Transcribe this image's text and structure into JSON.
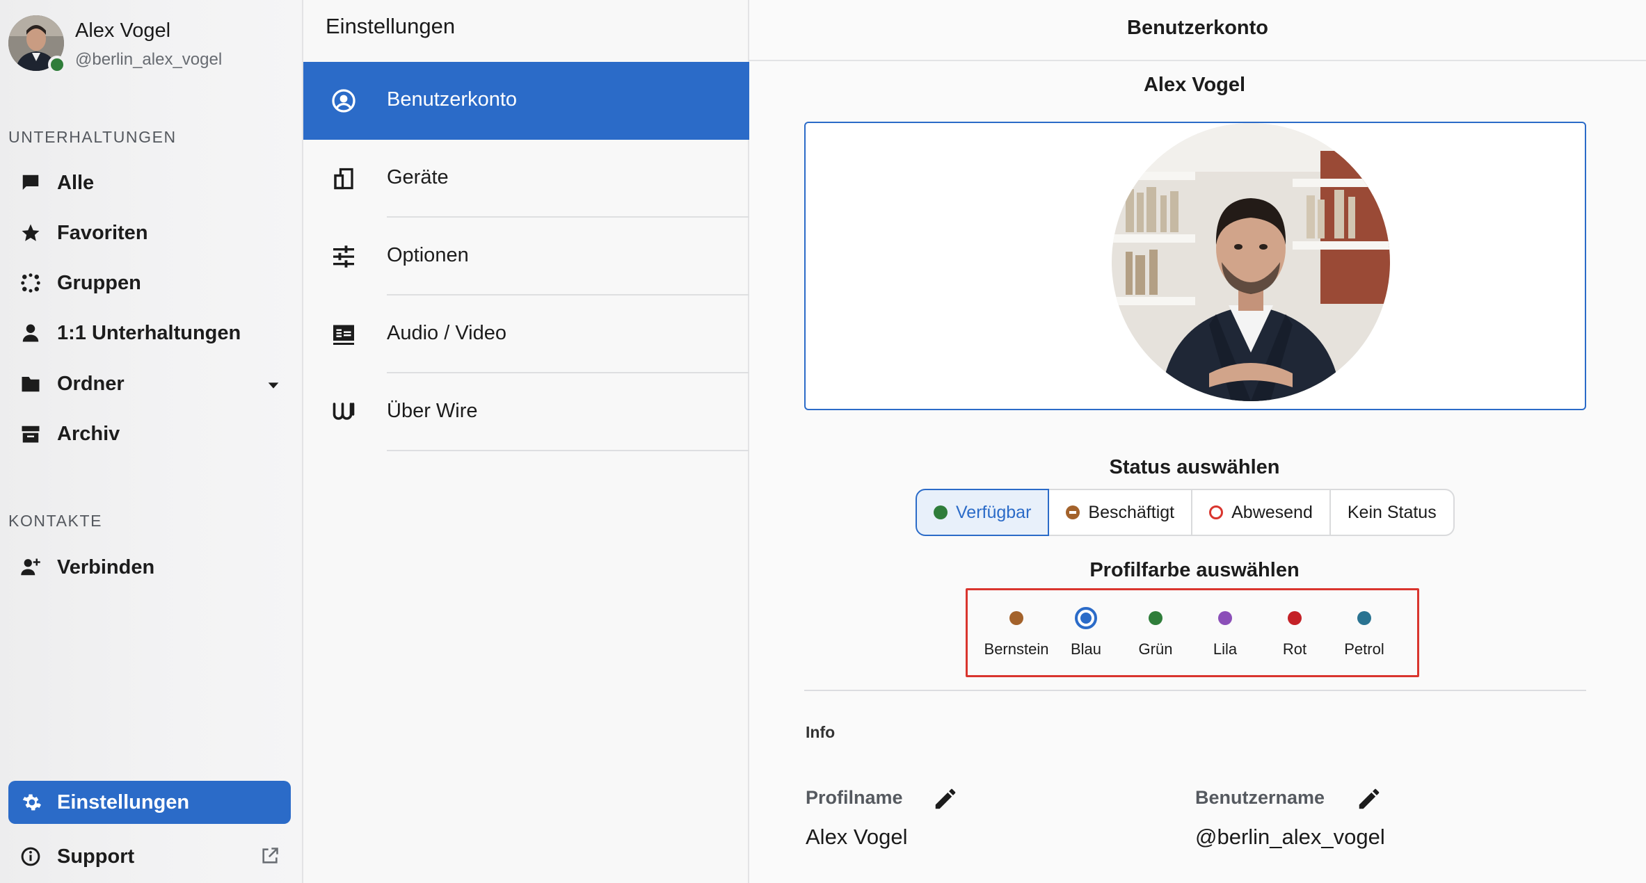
{
  "user": {
    "name": "Alex Vogel",
    "handle": "@berlin_alex_vogel",
    "online_color": "#2f7d3a"
  },
  "sidebar": {
    "conversations_label": "UNTERHALTUNGEN",
    "items": [
      {
        "label": "Alle",
        "icon": "chat-bubble-icon"
      },
      {
        "label": "Favoriten",
        "icon": "star-icon"
      },
      {
        "label": "Gruppen",
        "icon": "group-dots-icon"
      },
      {
        "label": "1:1 Unterhaltungen",
        "icon": "person-icon"
      },
      {
        "label": "Ordner",
        "icon": "folder-icon"
      },
      {
        "label": "Archiv",
        "icon": "archive-icon"
      }
    ],
    "contacts_label": "KONTAKTE",
    "connect_label": "Verbinden",
    "settings_label": "Einstellungen",
    "support_label": "Support",
    "accent": "#2b6bc8"
  },
  "settings_menu": {
    "title": "Einstellungen",
    "items": [
      {
        "label": "Benutzerkonto",
        "icon": "account-circle-icon"
      },
      {
        "label": "Geräte",
        "icon": "devices-icon"
      },
      {
        "label": "Optionen",
        "icon": "sliders-icon"
      },
      {
        "label": "Audio / Video",
        "icon": "av-icon"
      },
      {
        "label": "Über Wire",
        "icon": "wire-logo-icon"
      }
    ]
  },
  "account": {
    "header": "Benutzerkonto",
    "profile_name": "Alex Vogel",
    "status_heading": "Status auswählen",
    "statuses": [
      {
        "label": "Verfügbar",
        "color": "#2f7d3a",
        "selected": true
      },
      {
        "label": "Beschäftigt",
        "color": "#a3622b",
        "selected": false
      },
      {
        "label": "Abwesend",
        "color": "#d9352e",
        "selected": false
      },
      {
        "label": "Kein Status",
        "color": "",
        "selected": false
      }
    ],
    "color_heading": "Profilfarbe auswählen",
    "colors": [
      {
        "label": "Bernstein",
        "hex": "#a3622b",
        "selected": false
      },
      {
        "label": "Blau",
        "hex": "#2b6bc8",
        "selected": true
      },
      {
        "label": "Grün",
        "hex": "#2f7d3a",
        "selected": false
      },
      {
        "label": "Lila",
        "hex": "#8b4fb8",
        "selected": false
      },
      {
        "label": "Rot",
        "hex": "#c42127",
        "selected": false
      },
      {
        "label": "Petrol",
        "hex": "#2a7391",
        "selected": false
      }
    ],
    "info_label": "Info",
    "fields": [
      {
        "label": "Profilname",
        "value": "Alex Vogel"
      },
      {
        "label": "Benutzername",
        "value": "@berlin_alex_vogel"
      }
    ]
  }
}
